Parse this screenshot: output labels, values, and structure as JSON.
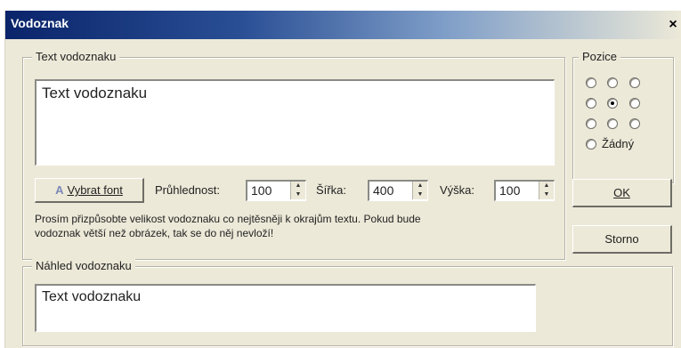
{
  "window": {
    "title": "Vodoznak",
    "close_glyph": "×"
  },
  "text_group": {
    "legend": "Text vodoznaku",
    "textarea_value": "Text vodoznaku",
    "font_button_label": "Vybrat font",
    "opacity_label": "Průhlednost:",
    "opacity_value": "100",
    "width_label": "Šířka:",
    "width_value": "400",
    "height_label": "Výška:",
    "height_value": "100",
    "hint_line1": "Prosím přizpůsobte velikost vodoznaku co nejtěsněji k okrajům textu. Pokud bude",
    "hint_line2": "vodoznak větší než obrázek, tak se do něj nevloží!"
  },
  "position_group": {
    "legend": "Pozice",
    "selected": "middle-center",
    "none_label": "Žádný"
  },
  "buttons": {
    "ok": "OK",
    "cancel": "Storno"
  },
  "preview_group": {
    "legend": "Náhled vodoznaku",
    "preview_text": "Text vodoznaku"
  },
  "icons": {
    "font_button": "font-icon",
    "close": "close-icon"
  }
}
